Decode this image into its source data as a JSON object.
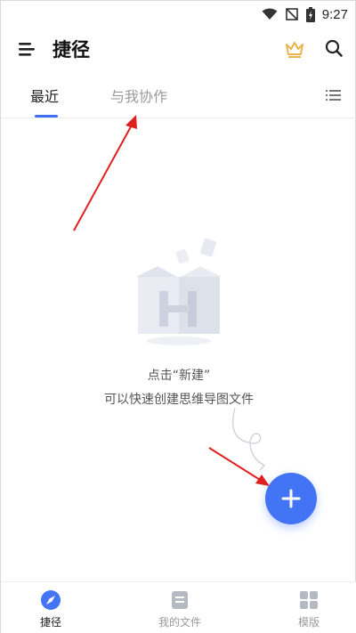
{
  "status_bar": {
    "time": "9:27"
  },
  "header": {
    "title": "捷径"
  },
  "tabs": [
    {
      "label": "最近",
      "active": true
    },
    {
      "label": "与我协作",
      "active": false
    }
  ],
  "empty_state": {
    "line1": "点击“新建”",
    "line2": "可以快速创建思维导图文件"
  },
  "bottom_nav": {
    "items": [
      {
        "label": "捷径",
        "icon": "compass-icon",
        "active": true
      },
      {
        "label": "我的文件",
        "icon": "file-icon",
        "active": false
      },
      {
        "label": "模版",
        "icon": "grid-icon",
        "active": false
      }
    ]
  },
  "colors": {
    "accent": "#4374f5",
    "crown": "#e9b44c",
    "annotation_arrow": "#e02020"
  }
}
